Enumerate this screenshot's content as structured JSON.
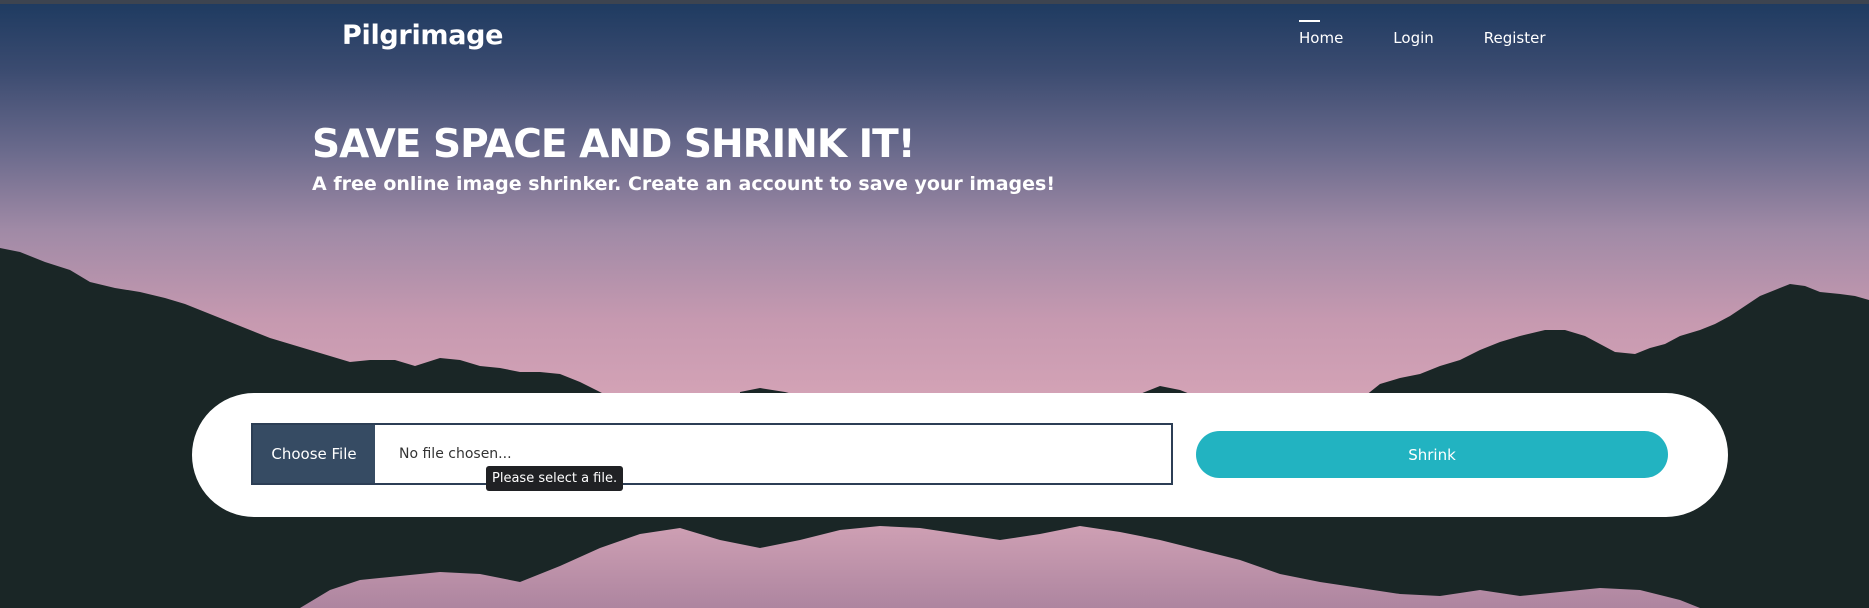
{
  "brand": "Pilgrimage",
  "nav": {
    "home": "Home",
    "login": "Login",
    "register": "Register"
  },
  "hero": {
    "title": "SAVE SPACE AND SHRINK IT!",
    "subtitle": "A free online image shrinker. Create an account to save your images!"
  },
  "form": {
    "choose_file_label": "Choose File",
    "file_status": "No file chosen...",
    "validation_tooltip": "Please select a file.",
    "submit_label": "Shrink"
  },
  "colors": {
    "accent": "#22b3c1",
    "file_button": "#364b63",
    "mountains": "#1a2626"
  }
}
